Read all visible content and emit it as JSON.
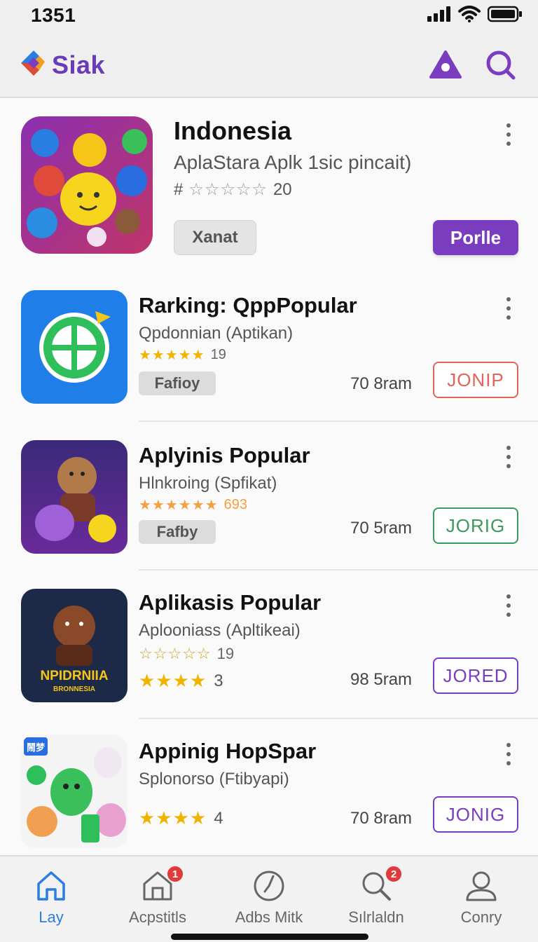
{
  "status_bar": {
    "time": "1351"
  },
  "header": {
    "app_name": "Siak"
  },
  "featured": {
    "title": "Indonesia",
    "subtitle": "AplaStara Aplk 1sic pincait)",
    "rating_prefix": "#",
    "rating_stars": "☆☆☆☆☆",
    "rating_count": "20",
    "secondary_button": "Xanat",
    "primary_button": "Porlle"
  },
  "items": [
    {
      "title": "Rarking: QppPopular",
      "subtitle": "Qpdonnian (Aptikan)",
      "stars": "★★★★★",
      "rating_count": "19",
      "tag": "Fafioy",
      "size": "70 8ram",
      "action": "JONIP",
      "action_color": "#e0645a"
    },
    {
      "title": "Aplyinis Popular",
      "subtitle": "Hlnkroing (Spfikat)",
      "stars": "★★★★★★",
      "rating_count": "693",
      "tag": "Fafby",
      "size": "70 5ram",
      "action": "JORIG",
      "action_color": "#3a9a5c"
    },
    {
      "title": "Aplikasis Popular",
      "subtitle": "Aplooniass (Apltikeai)",
      "stars": "☆☆☆☆☆",
      "rating_count": "19",
      "stars2": "★★★★",
      "rating_count2": "3",
      "icon_text": "NPIDRNIIA",
      "icon_subtext": "BRONNESIA",
      "size": "98 5ram",
      "action": "JORED",
      "action_color": "#7a3dbf"
    },
    {
      "title": "Appinig HopSpar",
      "subtitle": "Splonorso (Ftibyapi)",
      "stars2": "★★★★",
      "rating_count2": "4",
      "icon_text": "鬧梦",
      "size": "70 8ram",
      "action": "JONIG",
      "action_color": "#7a3dbf"
    }
  ],
  "bottom_nav": [
    {
      "label": "Lay",
      "icon": "home-icon",
      "active": true
    },
    {
      "label": "Acpstitls",
      "icon": "store-icon",
      "badge": "1"
    },
    {
      "label": "Adbs Mitk",
      "icon": "clock-icon"
    },
    {
      "label": "Sılrlaldn",
      "icon": "search-icon",
      "badge": "2"
    },
    {
      "label": "Conry",
      "icon": "profile-icon"
    }
  ],
  "colors": {
    "accent": "#7a3dbf",
    "active_nav": "#2a7de1",
    "star": "#f0b400",
    "badge": "#e03a3a"
  }
}
